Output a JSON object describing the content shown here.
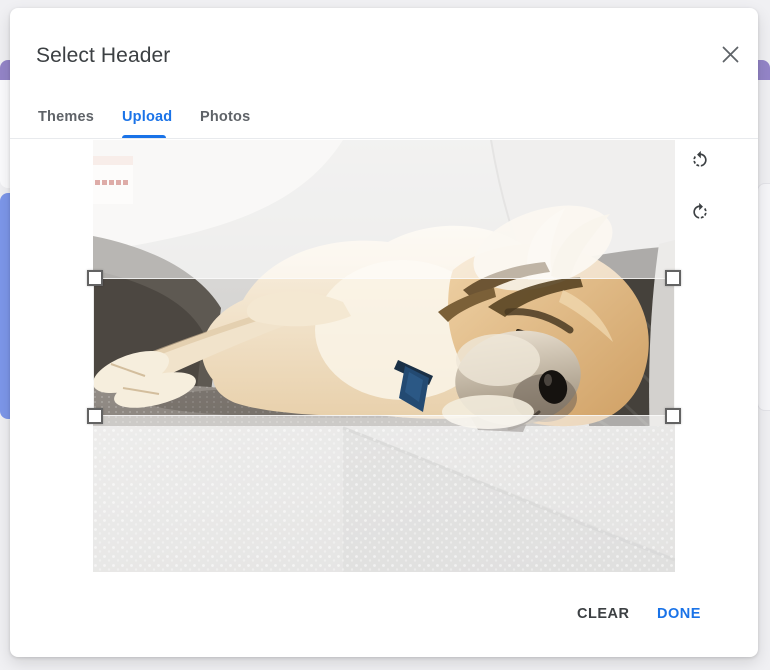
{
  "window": {
    "title": "Select Header"
  },
  "tabs": [
    {
      "label": "Themes",
      "active": false
    },
    {
      "label": "Upload",
      "active": true
    },
    {
      "label": "Photos",
      "active": false
    }
  ],
  "cropper": {
    "image_description": "Sleeping tan and white puppy lying on its side on a gray fabric couch, wearing a blue collar tag",
    "crop_shape": "wide horizontal banner band across the middle of the photo",
    "rotate_left_tooltip": "Rotate left",
    "rotate_right_tooltip": "Rotate right"
  },
  "footer": {
    "clear_label": "CLEAR",
    "done_label": "DONE"
  },
  "colors": {
    "accent_blue": "#1a73e8",
    "title_text": "#3c4043",
    "inactive_tab": "#5f6368",
    "backdrop_purple": "#9485c8",
    "backdrop_blue_border": "#7d97ea",
    "dim_overlay": "rgba(255,255,255,0.56)"
  }
}
